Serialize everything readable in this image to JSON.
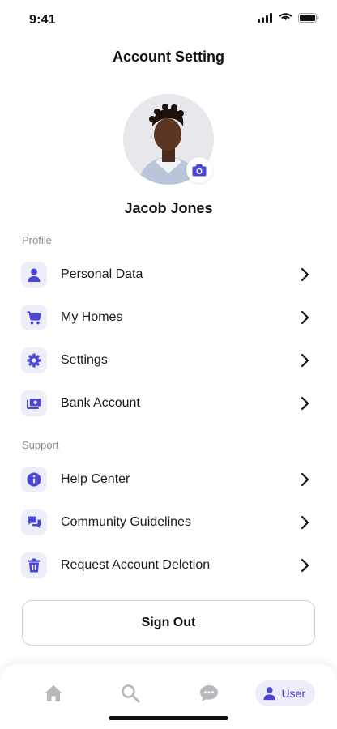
{
  "status_bar": {
    "time": "9:41",
    "icons": [
      "signal-icon",
      "wifi-icon",
      "battery-icon"
    ]
  },
  "header": {
    "title": "Account Setting"
  },
  "profile": {
    "name": "Jacob Jones",
    "avatar_icon": "avatar-photo",
    "camera_icon": "camera-icon"
  },
  "sections": {
    "profile_label": "Profile",
    "support_label": "Support"
  },
  "profile_items": [
    {
      "label": "Personal Data",
      "icon": "person-icon"
    },
    {
      "label": "My Homes",
      "icon": "cart-icon"
    },
    {
      "label": "Settings",
      "icon": "gear-icon"
    },
    {
      "label": "Bank Account",
      "icon": "bank-card-icon"
    }
  ],
  "support_items": [
    {
      "label": "Help Center",
      "icon": "info-icon"
    },
    {
      "label": "Community Guidelines",
      "icon": "chat-bubbles-icon"
    },
    {
      "label": "Request Account Deletion",
      "icon": "trash-icon"
    }
  ],
  "sign_out_label": "Sign Out",
  "tab_bar": {
    "tabs": [
      {
        "icon": "home-icon"
      },
      {
        "icon": "search-icon"
      },
      {
        "icon": "chat-icon"
      },
      {
        "icon": "user-icon",
        "label": "User",
        "active": true
      }
    ]
  },
  "colors": {
    "accent": "#4b47d6",
    "icon_bg": "#eeeefb",
    "tab_inactive": "#b8b8bc",
    "muted_text": "#8a8a8e"
  }
}
